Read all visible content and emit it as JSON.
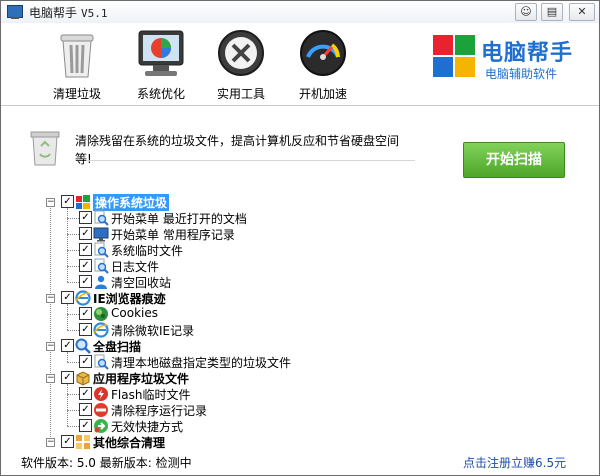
{
  "window": {
    "title": "电脑帮手",
    "version": "V5.1",
    "buttons": [
      "☺",
      "▤",
      "✕"
    ]
  },
  "toolbar": {
    "items": [
      {
        "label": "清理垃圾",
        "icon": "trash-can-icon"
      },
      {
        "label": "系统优化",
        "icon": "monitor-icon"
      },
      {
        "label": "实用工具",
        "icon": "tools-icon"
      },
      {
        "label": "开机加速",
        "icon": "speedometer-icon"
      }
    ]
  },
  "brand": {
    "name": "电脑帮手",
    "subtitle": "电脑辅助软件",
    "colors": [
      "#e8232f",
      "#1aa33a",
      "#1f6fd1",
      "#f5b400"
    ]
  },
  "info": {
    "description": "清除残留在系统的垃圾文件，提高计算机反应和节省硬盘空间等!",
    "scan_button": "开始扫描"
  },
  "tree": {
    "groups": [
      {
        "label": "操作系统垃圾",
        "icon": "windows-logo-icon",
        "checked": true,
        "selected": true,
        "items": [
          {
            "label": "开始菜单 最近打开的文档",
            "icon": "search-document-icon",
            "checked": true
          },
          {
            "label": "开始菜单 常用程序记录",
            "icon": "monitor-icon",
            "checked": true
          },
          {
            "label": "系统临时文件",
            "icon": "search-document-icon",
            "checked": true
          },
          {
            "label": "日志文件",
            "icon": "search-document-icon",
            "checked": true
          },
          {
            "label": "清空回收站",
            "icon": "user-icon",
            "checked": true
          }
        ]
      },
      {
        "label": "IE浏览器痕迹",
        "icon": "ie-icon",
        "checked": true,
        "items": [
          {
            "label": "Cookies",
            "icon": "cookies-icon",
            "checked": true
          },
          {
            "label": "清除微软IE记录",
            "icon": "ie-icon",
            "checked": true
          }
        ]
      },
      {
        "label": "全盘扫描",
        "icon": "magnifier-icon",
        "checked": true,
        "items": [
          {
            "label": "清理本地磁盘指定类型的垃圾文件",
            "icon": "search-document-icon",
            "checked": true
          }
        ]
      },
      {
        "label": "应用程序垃圾文件",
        "icon": "package-icon",
        "checked": true,
        "items": [
          {
            "label": "Flash临时文件",
            "icon": "flash-icon",
            "checked": true
          },
          {
            "label": "清除程序运行记录",
            "icon": "no-entry-icon",
            "checked": true
          },
          {
            "label": "无效快捷方式",
            "icon": "shortcut-icon",
            "checked": true
          }
        ]
      },
      {
        "label": "其他综合清理",
        "icon": "grid-icon",
        "checked": true,
        "items": []
      }
    ]
  },
  "status": {
    "version_text": "软件版本: 5.0 最新版本: 检测中",
    "register_link": "点击注册立赚6.5元"
  }
}
